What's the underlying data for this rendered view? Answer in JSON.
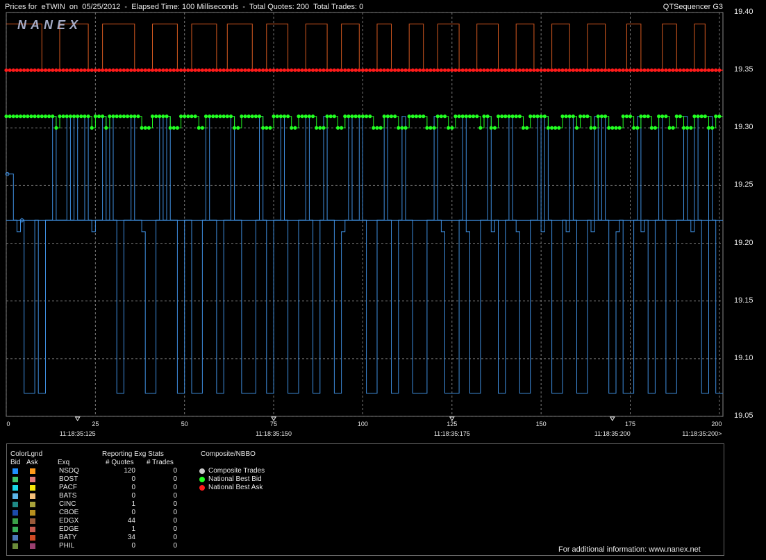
{
  "header": {
    "title": "Prices for  eTWIN  on  05/25/2012  -  Elapsed Time: 100 Milliseconds  -  Total Quotes: 200  Total Trades: 0",
    "brand": "QTSequencer G3"
  },
  "watermark": "NANEX",
  "colors": {
    "bid_line": "#3f8fe0",
    "ask_line": "#d85a20",
    "national_best_bid": "#22ff22",
    "national_best_ask": "#ff1a1a",
    "composite_trades": "#c8c8c8",
    "grid": "#7a7a7a"
  },
  "chart_data": {
    "type": "line",
    "y_axis": {
      "ticks": [
        "19.40",
        "19.35",
        "19.30",
        "19.25",
        "19.20",
        "19.15",
        "19.10",
        "19.05"
      ],
      "ylim": [
        19.05,
        19.4
      ]
    },
    "x_axis": {
      "ticks": [
        "0",
        "25",
        "50",
        "75",
        "100",
        "125",
        "150",
        "175",
        "200"
      ],
      "xlim": [
        0,
        201
      ]
    },
    "time_labels": [
      {
        "seq": 20,
        "label": "11:18:35:125"
      },
      {
        "seq": 75,
        "label": "11:18:35:150"
      },
      {
        "seq": 125,
        "label": "11:18:35:175"
      },
      {
        "seq": 170,
        "label": "11:18:35:200"
      },
      {
        "seq": 200,
        "label": "11:18:35:200>"
      }
    ],
    "series": [
      {
        "name": "National Best Ask",
        "key": "nba",
        "constant": 19.35
      },
      {
        "name": "National Best Bid",
        "key": "nbb",
        "levels": [
          19.3,
          19.31
        ]
      },
      {
        "name": "NSDQ Ask",
        "key": "ask",
        "levels": [
          19.35,
          19.39
        ]
      },
      {
        "name": "NSDQ Bid",
        "key": "bid",
        "levels": [
          19.07,
          19.21,
          19.22,
          19.31
        ]
      }
    ],
    "ask_high_intervals": [
      [
        10,
        15
      ],
      [
        23,
        27
      ],
      [
        36,
        41
      ],
      [
        48,
        52
      ],
      [
        59,
        62
      ],
      [
        69,
        73
      ],
      [
        79,
        84
      ],
      [
        90,
        94
      ],
      [
        99,
        104
      ],
      [
        108,
        113
      ],
      [
        117,
        121
      ],
      [
        127,
        132
      ],
      [
        138,
        143
      ],
      [
        148,
        153
      ],
      [
        158,
        163
      ],
      [
        168,
        174
      ],
      [
        178,
        184
      ],
      [
        188,
        193
      ],
      [
        196,
        201
      ]
    ],
    "bid_dips": [
      [
        5,
        8
      ],
      [
        9,
        11
      ],
      [
        31,
        33
      ],
      [
        39,
        42
      ],
      [
        48,
        50
      ],
      [
        52,
        55
      ],
      [
        59,
        61
      ],
      [
        66,
        70
      ],
      [
        73,
        75
      ],
      [
        79,
        82
      ],
      [
        86,
        88
      ],
      [
        92,
        94
      ],
      [
        101,
        104
      ],
      [
        108,
        110
      ],
      [
        114,
        118
      ],
      [
        123,
        127
      ],
      [
        130,
        133
      ],
      [
        138,
        140
      ],
      [
        144,
        147
      ],
      [
        153,
        156
      ],
      [
        160,
        163
      ],
      [
        169,
        171
      ],
      [
        173,
        176
      ],
      [
        180,
        182
      ],
      [
        185,
        188
      ],
      [
        195,
        197
      ],
      [
        199,
        201
      ]
    ],
    "bid_high": [
      [
        13,
        14
      ],
      [
        17,
        18
      ],
      [
        19,
        20
      ],
      [
        22,
        23
      ],
      [
        27,
        28
      ],
      [
        29,
        30
      ],
      [
        35,
        36
      ],
      [
        43,
        44
      ],
      [
        45,
        46
      ],
      [
        56,
        57
      ],
      [
        63,
        64
      ],
      [
        71,
        72
      ],
      [
        77,
        78
      ],
      [
        84,
        85
      ],
      [
        89,
        90
      ],
      [
        96,
        97
      ],
      [
        99,
        100
      ],
      [
        106,
        107
      ],
      [
        111,
        112
      ],
      [
        120,
        121
      ],
      [
        128,
        129
      ],
      [
        135,
        136
      ],
      [
        141,
        142
      ],
      [
        149,
        150
      ],
      [
        151,
        152
      ],
      [
        158,
        159
      ],
      [
        165,
        166
      ],
      [
        167,
        168
      ],
      [
        177,
        178
      ],
      [
        183,
        184
      ],
      [
        190,
        191
      ],
      [
        193,
        194
      ],
      [
        197,
        198
      ]
    ],
    "nbb_low": [
      [
        14,
        15
      ],
      [
        24,
        25
      ],
      [
        28,
        29
      ],
      [
        38,
        41
      ],
      [
        46,
        49
      ],
      [
        54,
        56
      ],
      [
        64,
        66
      ],
      [
        72,
        75
      ],
      [
        80,
        82
      ],
      [
        87,
        90
      ],
      [
        93,
        95
      ],
      [
        103,
        106
      ],
      [
        110,
        113
      ],
      [
        118,
        121
      ],
      [
        124,
        126
      ],
      [
        133,
        134
      ],
      [
        136,
        138
      ],
      [
        145,
        147
      ],
      [
        152,
        156
      ],
      [
        160,
        161
      ],
      [
        164,
        166
      ],
      [
        169,
        173
      ],
      [
        176,
        178
      ],
      [
        181,
        183
      ],
      [
        186,
        188
      ],
      [
        190,
        193
      ],
      [
        197,
        199
      ]
    ]
  },
  "legend": {
    "section_colorlgnd": "ColorLgnd",
    "bid_header": "Bid",
    "ask_header": "Ask",
    "section_stats": "Reporting Exg Stats",
    "exq_header": "Exq",
    "quotes_header": "# Quotes",
    "trades_header": "# Trades",
    "section_composite": "Composite/NBBO",
    "composite_items": [
      {
        "label": "Composite Trades",
        "color": "#c8c8c8"
      },
      {
        "label": "National Best Bid",
        "color": "#22ff22"
      },
      {
        "label": "National Best Ask",
        "color": "#ff1a1a"
      }
    ],
    "rows": [
      {
        "exq": "NSDQ",
        "quotes": "120",
        "trades": "0",
        "bid": "#1e8fff",
        "ask": "#ff9a1a"
      },
      {
        "exq": "BOST",
        "quotes": "0",
        "trades": "0",
        "bid": "#3fc46a",
        "ask": "#e07a7a"
      },
      {
        "exq": "PACF",
        "quotes": "0",
        "trades": "0",
        "bid": "#19d8e8",
        "ask": "#f5e60a"
      },
      {
        "exq": "BATS",
        "quotes": "0",
        "trades": "0",
        "bid": "#5ab4e8",
        "ask": "#f5c07a"
      },
      {
        "exq": "CINC",
        "quotes": "1",
        "trades": "0",
        "bid": "#1f8a86",
        "ask": "#a8a23a"
      },
      {
        "exq": "CBOE",
        "quotes": "0",
        "trades": "0",
        "bid": "#1c4aa8",
        "ask": "#b8901e"
      },
      {
        "exq": "EDGX",
        "quotes": "44",
        "trades": "0",
        "bid": "#3aa048",
        "ask": "#9a5a3a"
      },
      {
        "exq": "EDGE",
        "quotes": "1",
        "trades": "0",
        "bid": "#37b058",
        "ask": "#c85a50"
      },
      {
        "exq": "BATY",
        "quotes": "34",
        "trades": "0",
        "bid": "#4a78b8",
        "ask": "#d04a24"
      },
      {
        "exq": "PHIL",
        "quotes": "0",
        "trades": "0",
        "bid": "#6a8c3a",
        "ask": "#9a4070"
      }
    ],
    "footer": "For additional information: www.nanex.net"
  }
}
